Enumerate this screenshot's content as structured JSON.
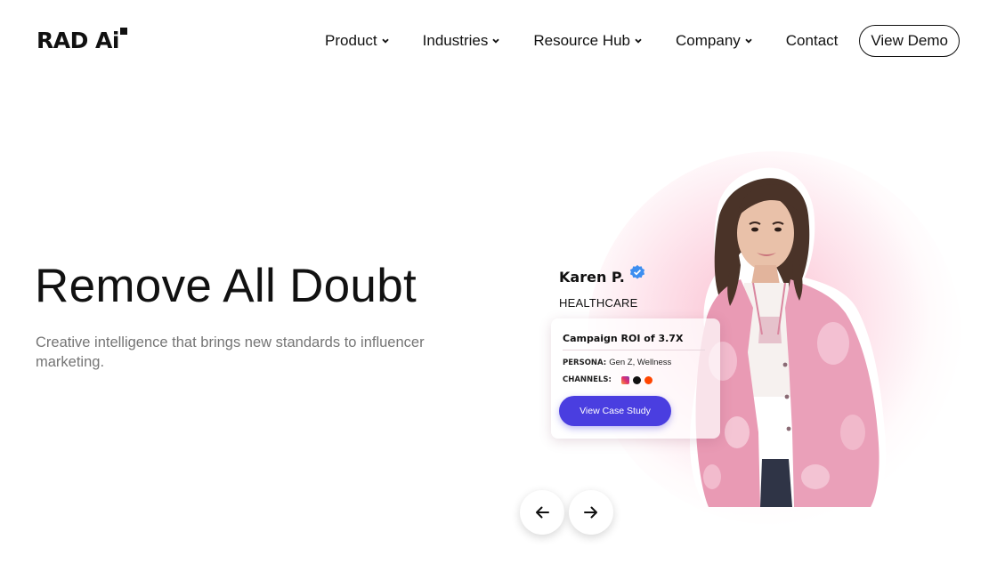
{
  "brand": {
    "name": "RAD Ai"
  },
  "nav": {
    "items": [
      {
        "label": "Product",
        "has_dropdown": true
      },
      {
        "label": "Industries",
        "has_dropdown": true
      },
      {
        "label": "Resource Hub",
        "has_dropdown": true
      },
      {
        "label": "Company",
        "has_dropdown": true
      }
    ],
    "contact_label": "Contact",
    "demo_label": "View Demo"
  },
  "hero": {
    "title": "Remove All Doubt",
    "subtitle": "Creative intelligence that brings new standards to influencer marketing."
  },
  "case_card": {
    "name": "Karen P.",
    "verified_icon": "verified-badge-icon",
    "industry": "HEALTHCARE",
    "roi": "Campaign ROI of 3.7X",
    "persona_label": "PERSONA:",
    "persona_value": "Gen Z, Wellness",
    "channels_label": "CHANNELS:",
    "channels": [
      "instagram-icon",
      "tiktok-icon",
      "reddit-icon"
    ],
    "cta_label": "View Case Study",
    "cta_color": "#4a3ee0"
  },
  "carousel": {
    "prev_icon": "arrow-left-icon",
    "next_icon": "arrow-right-icon"
  },
  "colors": {
    "text": "#111111",
    "subtitle": "#757575",
    "accent": "#4a3ee0",
    "glow": "#f88caa"
  }
}
